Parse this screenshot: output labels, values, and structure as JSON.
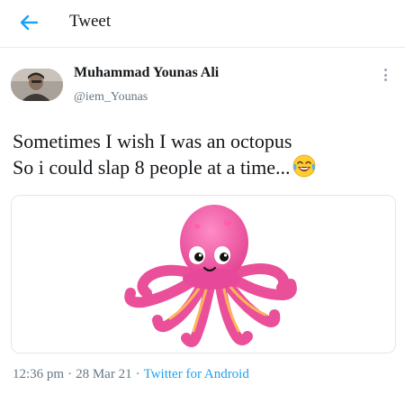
{
  "header": {
    "title": "Tweet",
    "back_icon": "arrow-left-icon"
  },
  "colors": {
    "accent": "#1da1f2",
    "text": "#14171a",
    "muted": "#657786",
    "border": "#e6ecf0",
    "octopus": "#f05aa0"
  },
  "tweet": {
    "author_name": "Muhammad Younas Ali",
    "author_handle": "@iem_Younas",
    "text_line1": "Sometimes I wish I was an octopus",
    "text_line2": "So i could slap 8 people at a time...",
    "emoji": "face-with-tears-of-joy",
    "time": "12:36 pm",
    "separator": "·",
    "date": "28 Mar 21",
    "source": "Twitter for Android"
  }
}
